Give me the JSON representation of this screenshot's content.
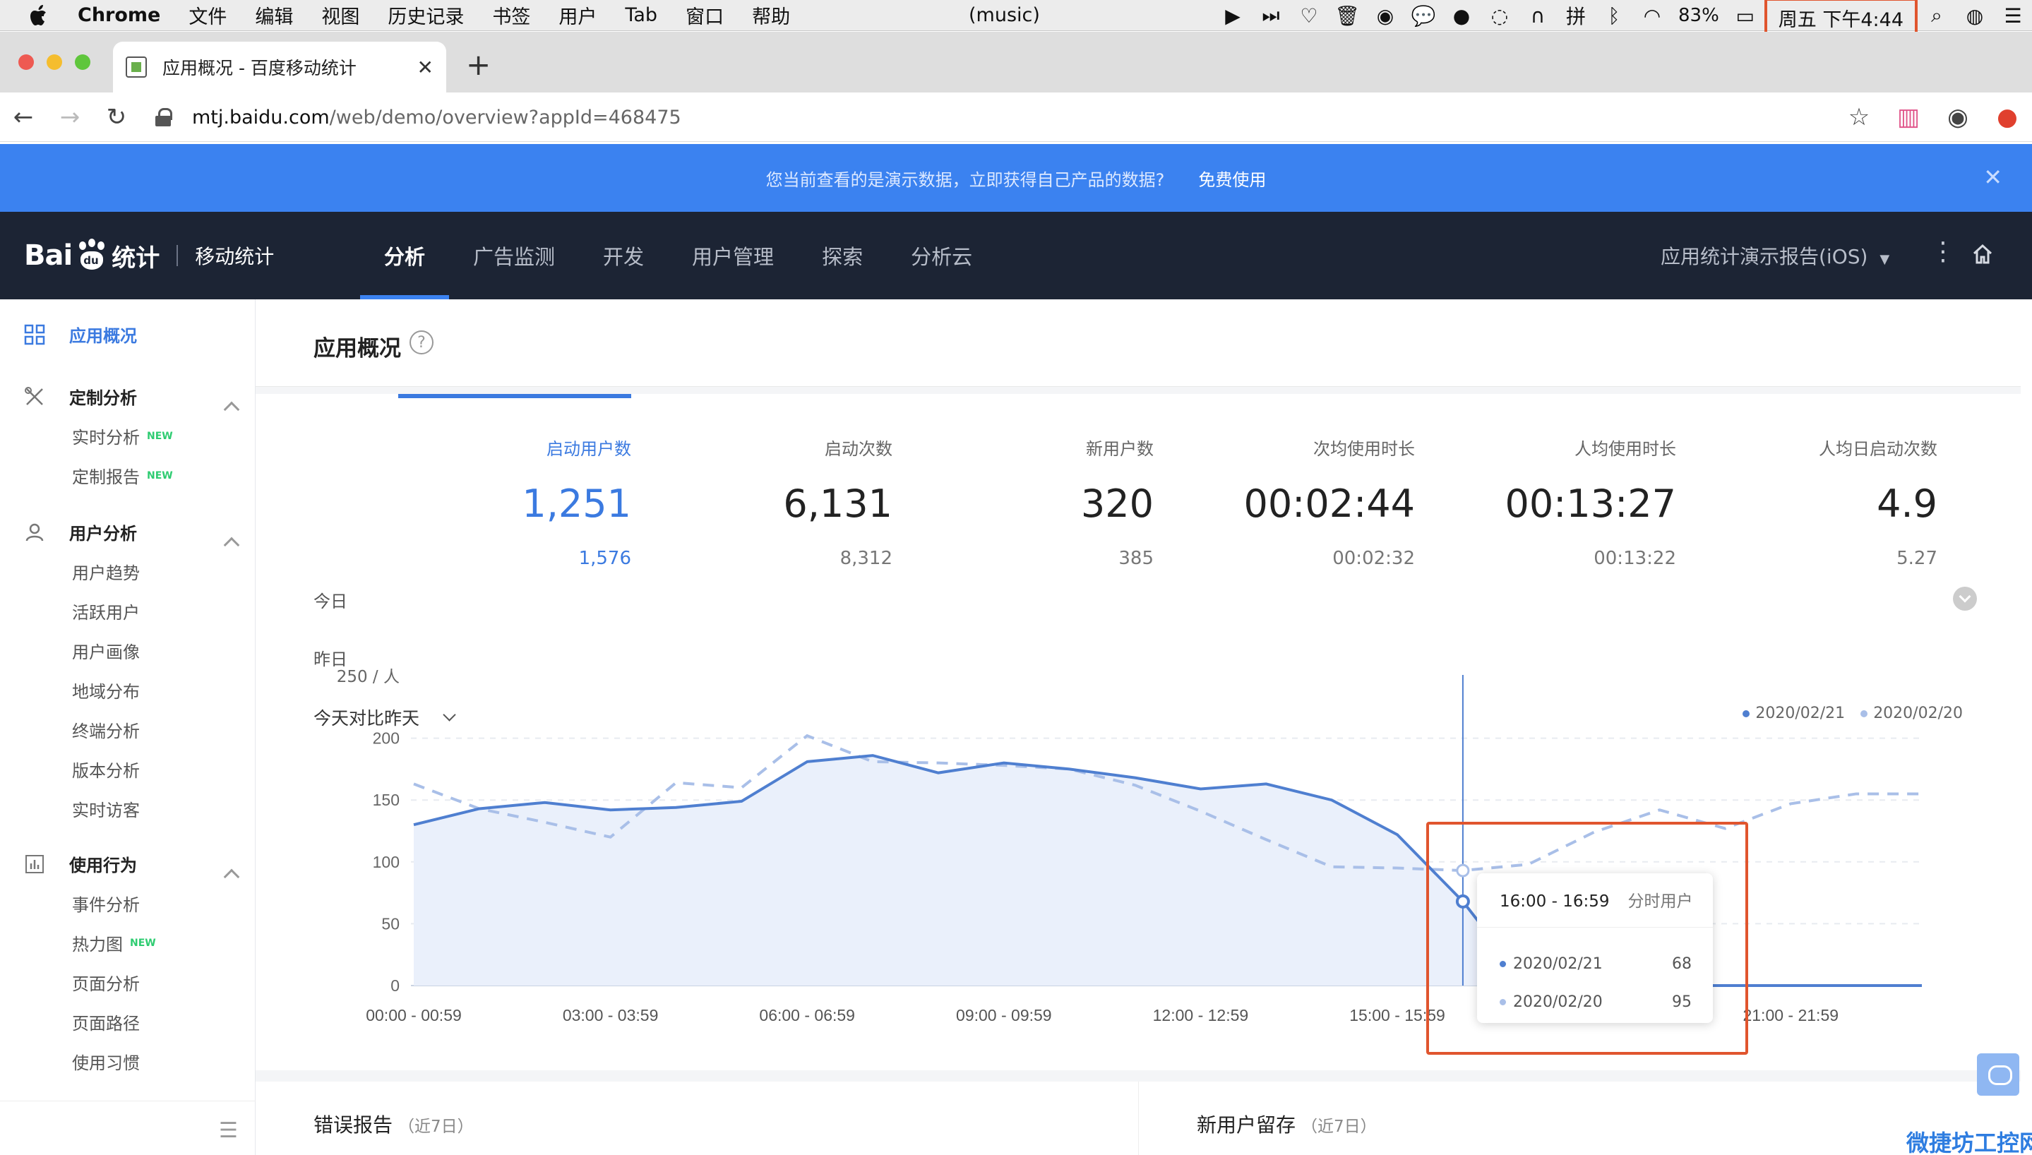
{
  "menubar": {
    "app": "Chrome",
    "menus": [
      "文件",
      "编辑",
      "视图",
      "历史记录",
      "书签",
      "用户",
      "Tab",
      "窗口",
      "帮助"
    ],
    "now_playing": "(music)",
    "battery": "83%",
    "clock": "周五 下午4:44"
  },
  "browser": {
    "tab_title": "应用概况 - 百度移动统计",
    "url_host": "mtj.baidu.com",
    "url_path": "/web/demo/overview?appId=468475"
  },
  "banner": {
    "text": "您当前查看的是演示数据，立即获得自己产品的数据?",
    "cta": "免费使用"
  },
  "header": {
    "logo_bai": "Bai",
    "logo_du": "du",
    "logo_tongji": "统计",
    "product": "移动统计",
    "nav": [
      "分析",
      "广告监测",
      "开发",
      "用户管理",
      "探索",
      "分析云"
    ],
    "active_nav": 0,
    "report_name": "应用统计演示报告(iOS)"
  },
  "sidebar": {
    "overview": "应用概况",
    "groups": [
      {
        "label": "定制分析",
        "items": [
          {
            "label": "实时分析",
            "new": "NEW"
          },
          {
            "label": "定制报告",
            "new": "NEW"
          }
        ]
      },
      {
        "label": "用户分析",
        "items": [
          {
            "label": "用户趋势"
          },
          {
            "label": "活跃用户"
          },
          {
            "label": "用户画像"
          },
          {
            "label": "地域分布"
          },
          {
            "label": "终端分析"
          },
          {
            "label": "版本分析"
          },
          {
            "label": "实时访客"
          }
        ]
      },
      {
        "label": "使用行为",
        "items": [
          {
            "label": "事件分析"
          },
          {
            "label": "热力图",
            "new": "NEW"
          },
          {
            "label": "页面分析"
          },
          {
            "label": "页面路径"
          },
          {
            "label": "使用习惯"
          }
        ]
      }
    ]
  },
  "page": {
    "title": "应用概况",
    "row_today": "今日",
    "row_yesterday": "昨日",
    "metrics": [
      {
        "label": "启动用户数",
        "today": "1,251",
        "yesterday": "1,576",
        "active": true
      },
      {
        "label": "启动次数",
        "today": "6,131",
        "yesterday": "8,312"
      },
      {
        "label": "新用户数",
        "today": "320",
        "yesterday": "385"
      },
      {
        "label": "次均使用时长",
        "today": "00:02:44",
        "yesterday": "00:02:32"
      },
      {
        "label": "人均使用时长",
        "today": "00:13:27",
        "yesterday": "00:13:22"
      },
      {
        "label": "人均日启动次数",
        "today": "4.9",
        "yesterday": "5.27"
      }
    ],
    "compare_label": "今天对比昨天"
  },
  "chart_data": {
    "type": "line",
    "y_unit_label": "250 / 人",
    "ylim": [
      0,
      250
    ],
    "yticks": [
      0,
      50,
      100,
      150,
      200
    ],
    "x_tick_labels": [
      "00:00 - 00:59",
      "03:00 - 03:59",
      "06:00 - 06:59",
      "09:00 - 09:59",
      "12:00 - 12:59",
      "15:00 - 15:59",
      "21:00 - 21:59"
    ],
    "x_tick_hours": [
      0,
      3,
      6,
      9,
      12,
      15,
      21
    ],
    "hours": 24,
    "grid": true,
    "legend_position": "top-right",
    "series": [
      {
        "name": "2020/02/21",
        "color": "#4f7fd0",
        "style": "solid-area",
        "values": [
          130,
          143,
          148,
          142,
          144,
          149,
          181,
          186,
          172,
          180,
          175,
          168,
          159,
          163,
          150,
          122,
          68,
          0,
          0,
          0,
          0,
          0,
          0,
          0
        ]
      },
      {
        "name": "2020/02/20",
        "color": "#a9bfe8",
        "style": "dashed",
        "values": [
          163,
          143,
          132,
          120,
          164,
          160,
          202,
          181,
          180,
          178,
          175,
          162,
          141,
          118,
          96,
          95,
          93,
          98,
          124,
          142,
          127,
          147,
          155,
          155
        ]
      }
    ],
    "tooltip": {
      "range": "16:00 - 16:59",
      "metric": "分时用户",
      "hour_index": 16,
      "rows": [
        {
          "name": "2020/02/21",
          "value": 68,
          "color": "#4f7fd0"
        },
        {
          "name": "2020/02/20",
          "value": 95,
          "color": "#a9bfe8"
        }
      ]
    }
  },
  "panels": {
    "errors": {
      "title": "错误报告",
      "hint": "（近7日）"
    },
    "retention": {
      "title": "新用户留存",
      "hint": "（近7日）"
    }
  },
  "watermark": "微捷坊工控网"
}
